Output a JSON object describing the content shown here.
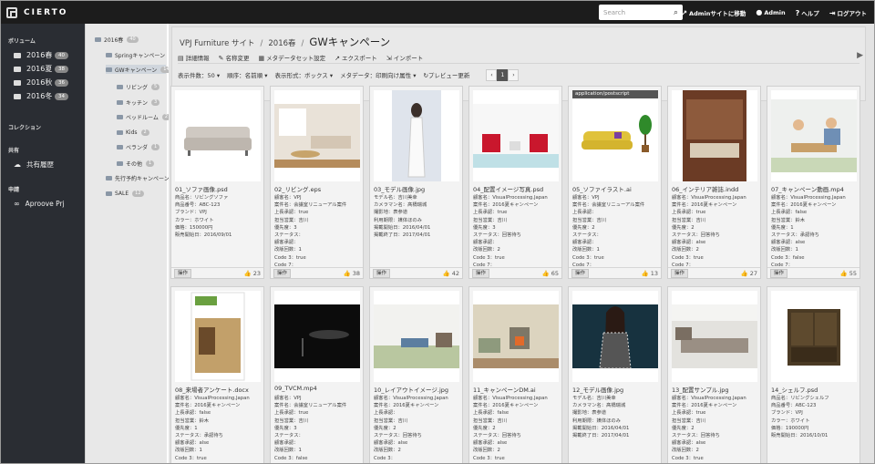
{
  "app": {
    "logo": "CIERTO"
  },
  "topbar": {
    "search_placeholder": "Search",
    "nav": [
      {
        "icon": "external-link-icon",
        "label": "Adminサイトに移動"
      },
      {
        "icon": "user-icon",
        "label": "Admin"
      },
      {
        "icon": "help-icon",
        "label": "ヘルプ"
      },
      {
        "icon": "logout-icon",
        "label": "ログアウト"
      }
    ]
  },
  "sidebar": {
    "volume_title": "ボリューム",
    "volumes": [
      {
        "label": "2016春",
        "count": "40"
      },
      {
        "label": "2016夏",
        "count": "38"
      },
      {
        "label": "2016秋",
        "count": "36"
      },
      {
        "label": "2016冬",
        "count": "34"
      }
    ],
    "collection_title": "コレクション",
    "shared_title": "共有",
    "shared_items": [
      {
        "icon": "cloud-icon",
        "label": "共有履歴"
      }
    ],
    "approval_title": "申請",
    "approval_items": [
      {
        "icon": "infinity-icon",
        "label": "Aproove Prj"
      }
    ]
  },
  "tree": [
    {
      "label": "2016春",
      "count": "40"
    },
    {
      "label": "Springキャンペーン",
      "count": ""
    },
    {
      "label": "GWキャンペーン",
      "count": "14"
    },
    {
      "label": "リビング",
      "count": "5"
    },
    {
      "label": "キッチン",
      "count": "3"
    },
    {
      "label": "ベッドルーム",
      "count": "2"
    },
    {
      "label": "Kids",
      "count": "2"
    },
    {
      "label": "ベランダ",
      "count": "1"
    },
    {
      "label": "その他",
      "count": "1"
    },
    {
      "label": "先行予約キャンペーン",
      "count": ""
    },
    {
      "label": "SALE",
      "count": "12"
    }
  ],
  "breadcrumb": {
    "site": "VPJ Furniture サイト",
    "volume": "2016春",
    "current": "GWキャンペーン"
  },
  "toolbar": [
    {
      "icon": "info-icon",
      "label": "詳細情報"
    },
    {
      "icon": "pencil-icon",
      "label": "名称変更"
    },
    {
      "icon": "metadata-icon",
      "label": "メタデータセット設定"
    },
    {
      "icon": "export-icon",
      "label": "エクスポート"
    },
    {
      "icon": "import-icon",
      "label": "インポート"
    }
  ],
  "viewbar": {
    "count": "表示件数：50",
    "sort": "順序：名前順",
    "format": "表示形式：ボックス",
    "metadata": "メタデータ：印刷向け属性",
    "preview": "プレビュー更新",
    "page": "1"
  },
  "op_label": "操作",
  "cards": [
    {
      "name": "01_ソファ画像.psd",
      "likes": "23",
      "tag": "",
      "meta": [
        "商品名：リビングソファ",
        "商品番号：ABC-123",
        "ブランド：VPJ",
        "カラー：ホワイト",
        "価格：150000円",
        "販売開始日：2016/09/01"
      ]
    },
    {
      "name": "02_リビング.eps",
      "likes": "38",
      "tag": "",
      "meta": [
        "顧客名：VPJ",
        "案件名：会議室リニューアル案件",
        "上長承認：true",
        "担当営業：吉川",
        "優先度：3",
        "ステータス：",
        "顧客承認：",
        "改版回数：1",
        "Code 3：true",
        "Code 7："
      ]
    },
    {
      "name": "03_モデル画像.jpg",
      "likes": "42",
      "tag": "",
      "meta": [
        "モデル名：吉川美幸",
        "カメラマン名：髙橋瑞城",
        "撮影地：表参道",
        "利用期限：媒体ほのみ",
        "掲載開始日：2016/04/01",
        "掲載終了日：2017/04/01"
      ]
    },
    {
      "name": "04_配置イメージ写真.psd",
      "likes": "65",
      "tag": "",
      "meta": [
        "顧客名：VisualProcessing.Japan",
        "案件名：2016夏キャンペーン",
        "上長承認：true",
        "担当営業：吉川",
        "優先度：3",
        "ステータス：回答待ち",
        "顧客承認：",
        "改版回数：2",
        "Code 3：true",
        "Code 7："
      ]
    },
    {
      "name": "05_ソファイラスト.ai",
      "likes": "13",
      "tag": "application/postscript",
      "meta": [
        "顧客名：VPJ",
        "案件名：会議室リニューアル案件",
        "上長承認：",
        "担当営業：吉川",
        "優先度：2",
        "ステータス：",
        "顧客承認：",
        "改版回数：1",
        "Code 3：true",
        "Code 7："
      ]
    },
    {
      "name": "06_インテリア雑誌.indd",
      "likes": "27",
      "tag": "",
      "meta": [
        "顧客名：VisualProcessing.Japan",
        "案件名：2016夏キャンペーン",
        "上長承認：true",
        "担当営業：吉川",
        "優先度：2",
        "ステータス：回答待ち",
        "顧客承認：alse",
        "改版回数：2",
        "Code 3：true",
        "Code 7："
      ]
    },
    {
      "name": "07_キャンペーン動画.mp4",
      "likes": "55",
      "tag": "",
      "meta": [
        "顧客名：VisualProcessing.Japan",
        "案件名：2016夏キャンペーン",
        "上長承認：false",
        "担当営業：鈴木",
        "優先度：1",
        "ステータス：承認待ち",
        "顧客承認：alse",
        "改版回数：1",
        "Code 3：false",
        "Code 7："
      ]
    },
    {
      "name": "08_来場者アンケート.docx",
      "likes": "",
      "tag": "",
      "meta": [
        "顧客名：VisualProcessing.Japan",
        "案件名：2016夏キャンペーン",
        "上長承認：false",
        "担当営業：鈴木",
        "優先度：1",
        "ステータス：承認待ち",
        "顧客承認：alse",
        "改版回数：1",
        "Code 3：true",
        "Code 7："
      ]
    },
    {
      "name": "09_TVCM.mp4",
      "likes": "",
      "tag": "",
      "meta": [
        "顧客名：VPJ",
        "案件名：会議室リニューアル案件",
        "上長承認：true",
        "担当営業：吉川",
        "優先度：3",
        "ステータス：",
        "顧客承認：",
        "改版回数：1",
        "Code 3：false",
        "Code 7："
      ]
    },
    {
      "name": "10_レイアウトイメージ.jpg",
      "likes": "",
      "tag": "",
      "meta": [
        "顧客名：VisualProcessing.Japan",
        "案件名：2016夏キャンペーン",
        "上長承認：",
        "担当営業：吉川",
        "優先度：2",
        "ステータス：回答待ち",
        "顧客承認：alse",
        "改版回数：2",
        "Code 3：",
        "Code 7："
      ]
    },
    {
      "name": "11_キャンペーンDM.ai",
      "likes": "",
      "tag": "",
      "meta": [
        "顧客名：VisualProcessing.Japan",
        "案件名：2016夏キャンペーン",
        "上長承認：false",
        "担当営業：吉川",
        "優先度：2",
        "ステータス：回答待ち",
        "顧客承認：alse",
        "改版回数：2",
        "Code 3：true",
        "Code 7："
      ]
    },
    {
      "name": "12_モデル画像.jpg",
      "likes": "",
      "tag": "",
      "meta": [
        "モデル名：吉川美幸",
        "カメラマン名：髙橋瑞城",
        "撮影地：表参道",
        "利用期限：媒体ほのみ",
        "掲載開始日：2016/04/01",
        "掲載終了日：2017/04/01"
      ]
    },
    {
      "name": "13_配置サンプル.jpg",
      "likes": "",
      "tag": "",
      "meta": [
        "顧客名：VisualProcessing.Japan",
        "案件名：2016夏キャンペーン",
        "上長承認：true",
        "担当営業：吉川",
        "優先度：2",
        "ステータス：回答待ち",
        "顧客承認：alse",
        "改版回数：2",
        "Code 3：true",
        "Code 7："
      ]
    },
    {
      "name": "14_シェルフ.psd",
      "likes": "",
      "tag": "",
      "meta": [
        "商品名：リビングシェルフ",
        "商品番号：ABC-123",
        "ブランド：VPJ",
        "カラー：ホワイト",
        "価格：190000円",
        "販売開始日：2016/10/01"
      ]
    }
  ]
}
